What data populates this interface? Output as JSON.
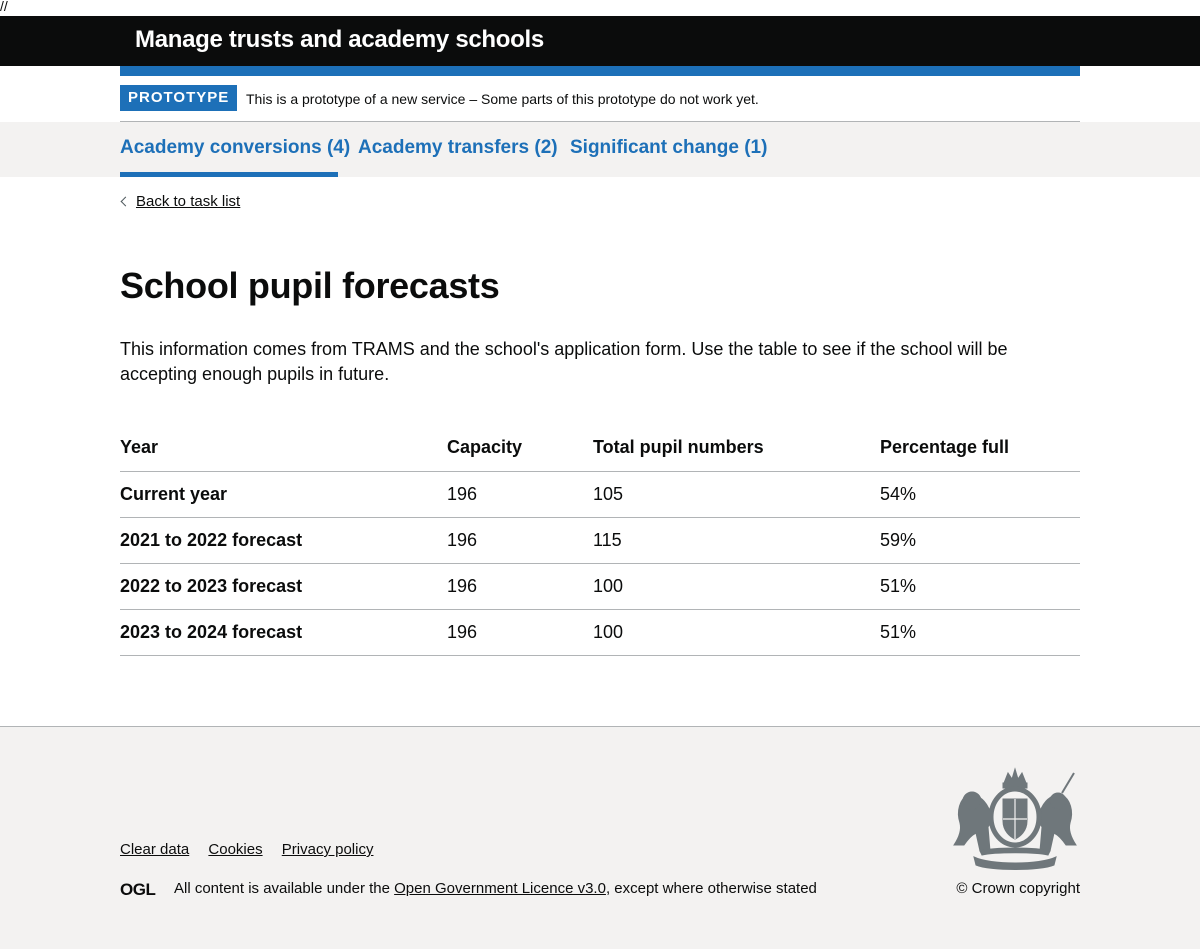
{
  "stray_mark": "//",
  "header": {
    "title": "Manage trusts and academy schools"
  },
  "phase_banner": {
    "tag": "PROTOTYPE",
    "text": "This is a prototype of a new service – Some parts of this prototype do not work yet."
  },
  "tabs": [
    {
      "label": "Academy conversions (4)",
      "active": true
    },
    {
      "label": "Academy transfers (2)",
      "active": false
    },
    {
      "label": "Significant change (1)",
      "active": false
    }
  ],
  "back_link": {
    "label": "Back to task list"
  },
  "page": {
    "title": "School pupil forecasts",
    "intro": "This information comes from TRAMS and the school's application form. Use the table to see if the school will be accepting enough pupils in future."
  },
  "table": {
    "headers": [
      "Year",
      "Capacity",
      "Total pupil numbers",
      "Percentage full"
    ],
    "rows": [
      [
        "Current year",
        "196",
        "105",
        "54%"
      ],
      [
        "2021 to 2022 forecast",
        "196",
        "115",
        "59%"
      ],
      [
        "2022 to 2023 forecast",
        "196",
        "100",
        "51%"
      ],
      [
        "2023 to 2024 forecast",
        "196",
        "100",
        "51%"
      ]
    ]
  },
  "footer": {
    "links": [
      "Clear data",
      "Cookies",
      "Privacy policy"
    ],
    "ogl_logo_text": "OGL",
    "licence_prefix": "All content is available under the ",
    "licence_link": "Open Government Licence v3.0",
    "licence_suffix": ", except where otherwise stated",
    "copyright": "© Crown copyright",
    "crest_icon": "royal-coat-of-arms-icon"
  },
  "colors": {
    "header_bg": "#0b0c0c",
    "brand_blue": "#1d70b8",
    "footer_bg": "#f3f2f1",
    "border": "#b1b4b6"
  }
}
